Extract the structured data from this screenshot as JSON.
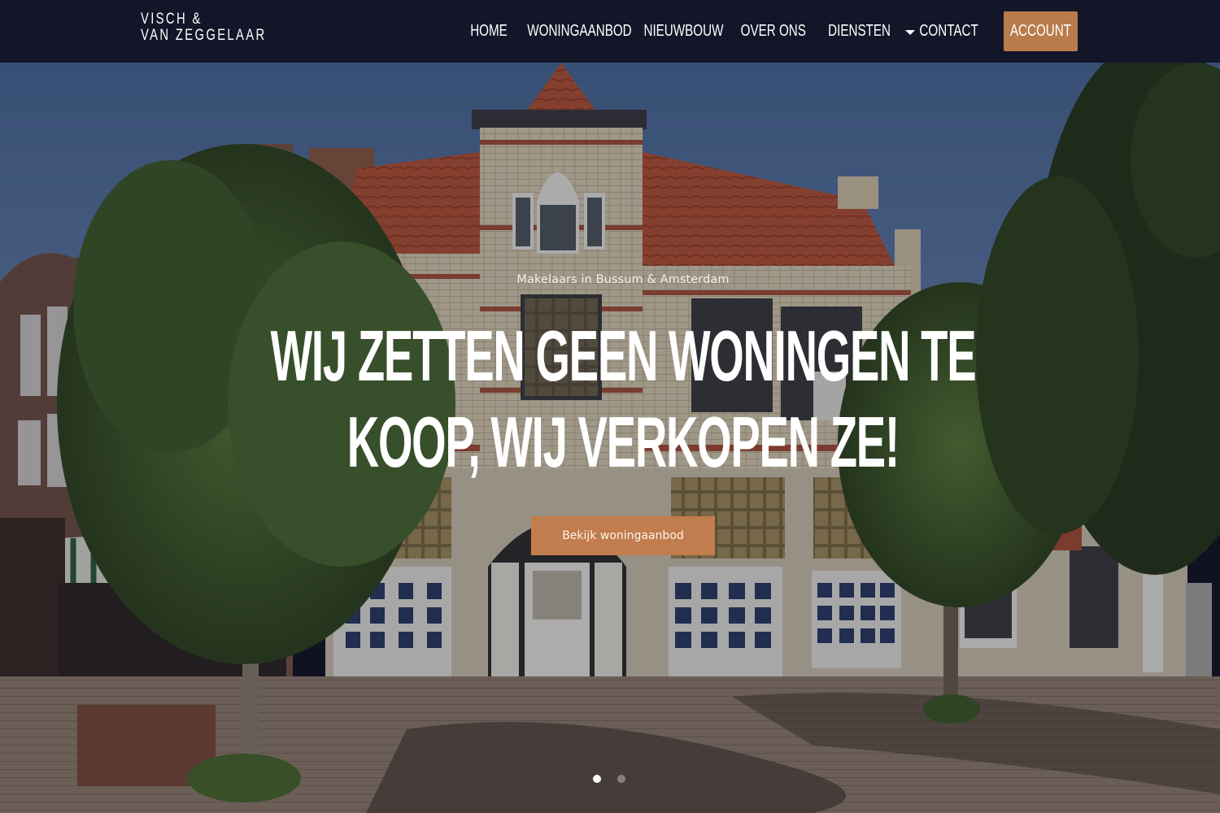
{
  "header": {
    "logo_line1": "VISCH &",
    "logo_line2": "VAN ZEGGELAAR",
    "nav": [
      {
        "label": "HOME"
      },
      {
        "label": "WONINGAANBOD"
      },
      {
        "label": "NIEUWBOUW"
      },
      {
        "label": "OVER ONS"
      },
      {
        "label": "DIENSTEN",
        "has_dropdown": true
      },
      {
        "label": "CONTACT"
      }
    ],
    "account_label": "ACCOUNT"
  },
  "hero": {
    "subtitle": "Makelaars in Bussum & Amsterdam",
    "title_line1": "WIJ ZETTEN GEEN WONINGEN TE",
    "title_line2": "KOOP, WIJ VERKOPEN ZE!",
    "cta_label": "Bekijk woningaanbod",
    "background_image": "Corner brick building with red tiled roof and real-estate office windows, trees and paved street",
    "slides": {
      "count": 2,
      "active": 1
    }
  },
  "colors": {
    "header_bg": "#131628",
    "accent": "#b97b4b",
    "cta_bg": "#c27d4e",
    "text": "#ffffff"
  }
}
